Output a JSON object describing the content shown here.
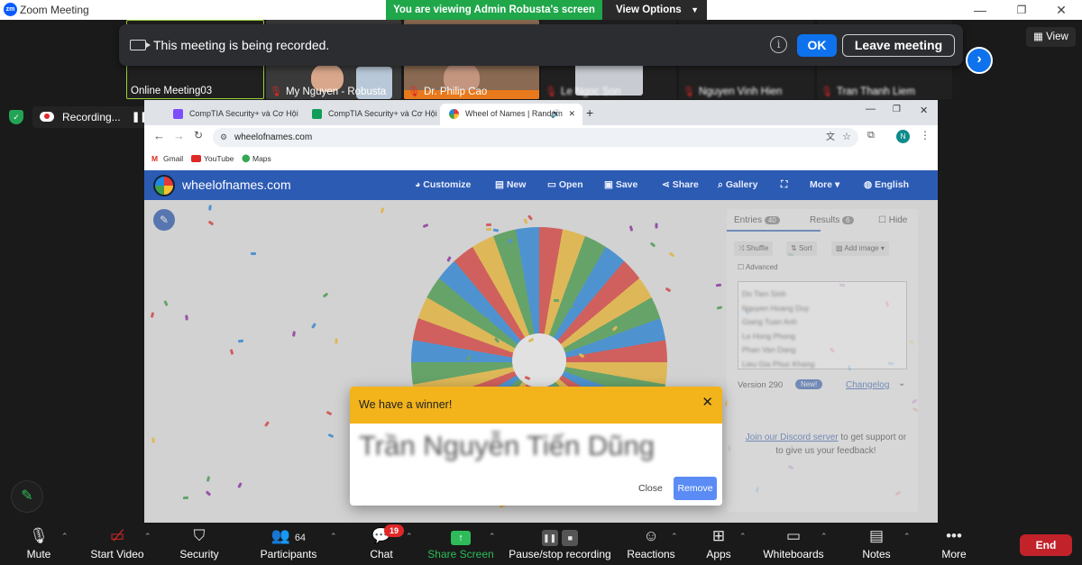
{
  "window": {
    "title": "Zoom Meeting",
    "logo_text": "zm"
  },
  "share_banner": {
    "text": "You are viewing Admin Robusta's screen",
    "view_options": "View Options"
  },
  "gallery": {
    "tiles": [
      {
        "name": "Online Meeting03"
      },
      {
        "name": "My Nguyen - Robusta"
      },
      {
        "name": "Dr. Philip Cao"
      },
      {
        "name": "Le Ngoc Son"
      },
      {
        "name": "Nguyen Vinh Hien"
      },
      {
        "name": "Tran Thanh Liem"
      }
    ],
    "view_label": "View"
  },
  "recording_notice": {
    "text": "This meeting is being recorded.",
    "info": "i",
    "ok": "OK",
    "leave": "Leave meeting"
  },
  "recording_bar": {
    "label": "Recording...",
    "pause": "❚❚"
  },
  "browser": {
    "tabs": [
      {
        "title": "CompTIA Security+ và Cơ Hội"
      },
      {
        "title": "CompTIA Security+ và Cơ Hội"
      },
      {
        "title": "Wheel of Names | Random"
      }
    ],
    "url": "wheelofnames.com",
    "bookmarks": [
      "Gmail",
      "YouTube",
      "Maps"
    ],
    "profile_initial": "N"
  },
  "won": {
    "brand": "wheelofnames.com",
    "menu": [
      "Customize",
      "New",
      "Open",
      "Save",
      "Share",
      "Gallery",
      "More",
      "English"
    ],
    "panel": {
      "entries_tab": "Entries",
      "entries_count": "40",
      "results_tab": "Results",
      "results_count": "6",
      "hide": "Hide",
      "shuffle": "Shuffle",
      "sort": "Sort",
      "add_image": "Add image",
      "advanced": "Advanced",
      "entries": [
        "Do Tien Sinh",
        "Nguyen Hoang Duy",
        "Giang Tuan Anh",
        "Le Hong Phong",
        "Phan Van Dang",
        "Lieu Gia Phuc Khang"
      ],
      "version": "Version 290",
      "new_badge": "New!",
      "changelog": "Changelog",
      "discord_link": "Join our Discord server",
      "discord_rest": " to get support or to give us your feedback!"
    },
    "dialog": {
      "title": "We have a winner!",
      "winner": "Trần Nguyễn Tiến Dũng",
      "close": "Close",
      "remove": "Remove"
    }
  },
  "toolbar": {
    "items": [
      {
        "label": "Mute"
      },
      {
        "label": "Start Video"
      },
      {
        "label": "Security"
      },
      {
        "label": "Participants",
        "count": "64"
      },
      {
        "label": "Chat",
        "badge": "19"
      },
      {
        "label": "Share Screen"
      },
      {
        "label": "Pause/stop recording"
      },
      {
        "label": "Reactions"
      },
      {
        "label": "Apps"
      },
      {
        "label": "Whiteboards"
      },
      {
        "label": "Notes"
      },
      {
        "label": "More"
      }
    ],
    "end": "End"
  },
  "colors": {
    "zoom_blue": "#0e72ed",
    "share_green": "#1fa74a",
    "won_header": "#2c5bb4",
    "dialog_head": "#f2b31b",
    "end_red": "#c2222a"
  }
}
